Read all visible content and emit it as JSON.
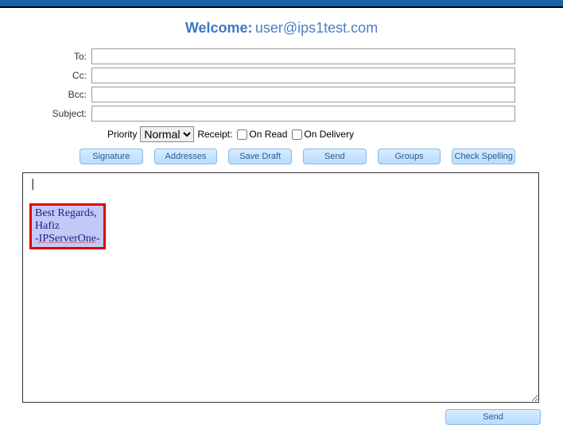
{
  "welcome": {
    "label": "Welcome:",
    "user": "user@ips1test.com"
  },
  "fields": {
    "to_label": "To:",
    "to_value": "",
    "cc_label": "Cc:",
    "cc_value": "",
    "bcc_label": "Bcc:",
    "bcc_value": "",
    "subject_label": "Subject:",
    "subject_value": ""
  },
  "priority": {
    "label": "Priority",
    "selected": "Normal",
    "receipt_label": "Receipt:",
    "on_read_label": "On Read",
    "on_delivery_label": "On Delivery"
  },
  "buttons": {
    "signature": "Signature",
    "addresses": "Addresses",
    "save_draft": "Save Draft",
    "send": "Send",
    "groups": "Groups",
    "check_spelling": "Check Spelling"
  },
  "editor": {
    "cursor": "|",
    "sig_line1": "Best Regards,",
    "sig_line2": "Hafiz",
    "sig_line3_pre": "-",
    "sig_line3_mid": "IPServerOne",
    "sig_line3_post": "-"
  },
  "bottom": {
    "send": "Send"
  }
}
